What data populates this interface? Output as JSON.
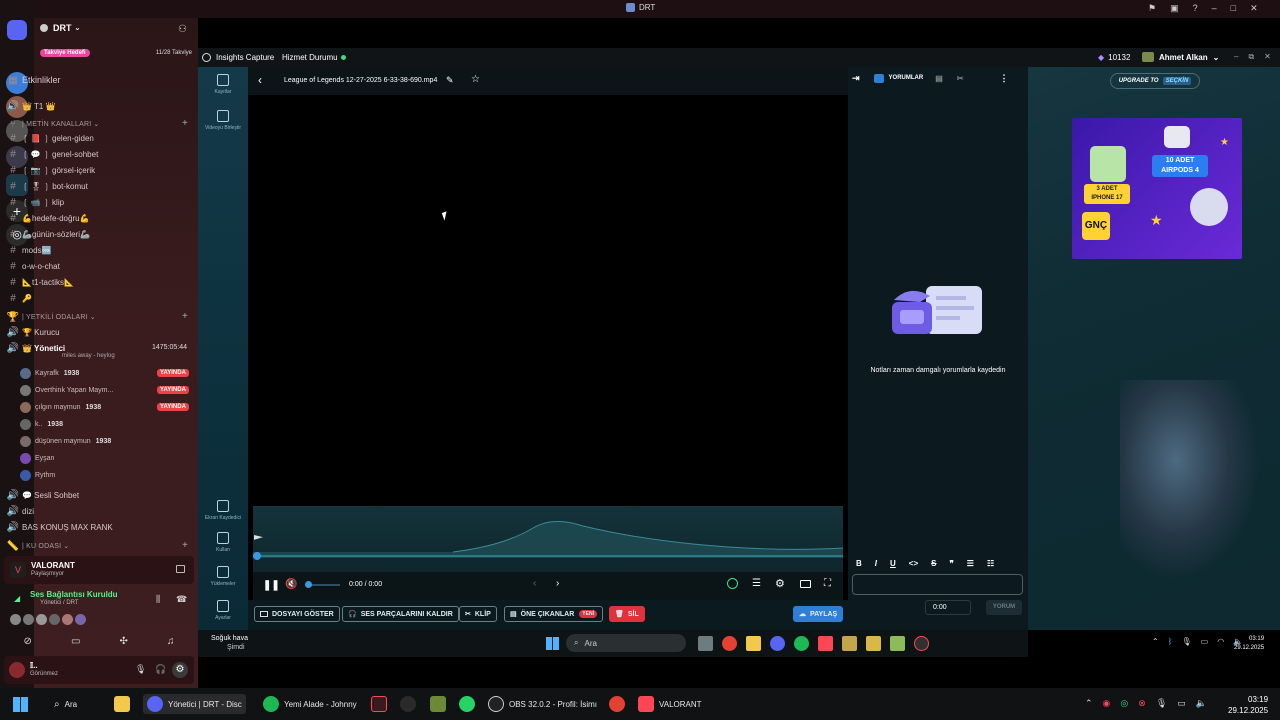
{
  "window_title": "DRT",
  "discord": {
    "server": "DRT",
    "boost_goal": "Takviye Hedefi",
    "boost_count": "11/28 Takviye",
    "events": "Etkinlikler",
    "t1": "👑 T1 👑",
    "cat_text": "| METİN KANALLARI",
    "channels": [
      "❲ 📕 ❳ gelen-giden",
      "❲ 💬 ❳ genel-sohbet",
      "❲ 📷 ❳ görsel-içerik",
      "❲ 🎖 ❳ bot-komut",
      "❲ 📹 ❳ klip",
      "💪hedefe-doğru💪",
      "🦾günün-sözleri🦾",
      "mods🆒",
      "o-w-o-chat",
      "📐t1-tactiks📐",
      "🔑"
    ],
    "cat_voice": "| YETKİLİ ODALARI",
    "voice_kurucu": "🏆 Kurucu",
    "voice_yonetici": "👑 Yönetici",
    "voice_timer": "1475:05:44",
    "voice_status": "miles away - heylog",
    "voice_users": [
      {
        "name": "Kayrafk",
        "extra": "1938",
        "live": true
      },
      {
        "name": "Overthink Yapan Maym...",
        "extra": "",
        "live": true
      },
      {
        "name": "çılgın maymun",
        "extra": "1938",
        "live": true
      },
      {
        "name": "k..",
        "extra": "1938",
        "live": false
      },
      {
        "name": "düşünen maymun",
        "extra": "1938",
        "live": false
      },
      {
        "name": "Eyşan",
        "extra": "",
        "live": false
      },
      {
        "name": "Rythm",
        "extra": "",
        "live": false
      }
    ],
    "live_label": "YAYINDA",
    "voice_other": [
      "💬 Sesli Sohbet",
      "dizi",
      "BAS KONUŞ MAX RANK"
    ],
    "cat_ku": "| KU ODASI",
    "activity_game": "VALORANT",
    "activity_sub": "Paylaşmıyor",
    "connection": "Ses Bağlantısı Kuruldu",
    "connection_sub": "Yönetici / DRT",
    "user_name": "𝕀..",
    "user_status": "Görünmez"
  },
  "app": {
    "brand": "Insights Capture",
    "service_status": "Hizmet Durumu",
    "coins": "10132",
    "user": "Ahmet Alkan",
    "side": [
      {
        "label": "Kayıtlar"
      },
      {
        "label": "Videoyu Birleştir"
      },
      {
        "label": "Ekran Kaydedici"
      },
      {
        "label": "Kullan"
      },
      {
        "label": "Yüklemeler"
      },
      {
        "label": "Ayarlar"
      }
    ],
    "file_title": "League of Legends 12-27-2025 6-33-38-690.mp4",
    "time": "0:00 / 0:00",
    "actions": {
      "show_file": "DOSYAYI GÖSTER",
      "remove_audio": "SES PARÇALARINI KALDIR",
      "clip": "KLİP",
      "highlights": "ÖNE ÇIKANLAR",
      "new": "YENİ",
      "delete": "SİL",
      "share": "PAYLAŞ"
    },
    "notes": {
      "tab": "YORUMLAR",
      "empty": "Notları zaman damgalı yorumlarla kaydedin",
      "time": "0:00",
      "submit": "YORUM"
    },
    "upgrade": {
      "prefix": "UPGRADE TO",
      "highlight": "SEÇKİN"
    },
    "ad": {
      "left_count": "3 ADET",
      "left_item": "IPHONE 17",
      "right_count": "10 ADET",
      "right_item": "AIRPODS 4",
      "brand": "GNÇ"
    }
  },
  "inner_taskbar": {
    "weather": "Soğuk hava",
    "weather_sub": "Şimdi",
    "search": "Ara",
    "time": "03:19",
    "date": "29.12.2025"
  },
  "taskbar": {
    "search": "Ara",
    "items": [
      "Yönetici | DRT - Disc",
      "Yemi Alade - Johnny",
      "OBS 32.0.2 - Profil: İsimı",
      "VALORANT"
    ],
    "time": "03:19",
    "date": "29.12.2025"
  }
}
